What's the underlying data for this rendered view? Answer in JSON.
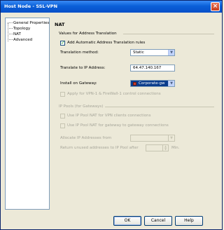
{
  "window": {
    "title": "Host Node - SSL-VPN",
    "close_icon": "close-icon"
  },
  "tree": {
    "items": [
      {
        "label": "General Properties"
      },
      {
        "label": "Topology"
      },
      {
        "label": "NAT"
      },
      {
        "label": "Advanced"
      }
    ]
  },
  "nat": {
    "heading": "NAT",
    "section_title": "Values for Address Translation",
    "add_auto_rules_label": "Add Automatic Address Translation rules",
    "add_auto_rules_checked": true,
    "translation_method_label": "Translation method:",
    "translation_method_value": "Static",
    "translate_ip_label": "Translate to IP Address:",
    "translate_ip_value": "64.47.140.167",
    "install_on_label": "Install on Gateway:",
    "install_on_value": "Corporate-gw",
    "apply_vpn_label": "Apply for VPN-1 & FireWall-1 control connections",
    "ip_pools_title": "IP Pools (for Gateways)",
    "use_pool_nat_label": "Use IP Pool NAT for VPN clients connections",
    "use_pool_nat_gw_label": "Use IP Pool NAT for gateway to gateway connections",
    "allocate_label": "Allocate IP Addresses from",
    "return_unused_label": "Return unused addresses to IP Pool after",
    "min_unit": "Min."
  },
  "buttons": {
    "ok": "OK",
    "cancel": "Cancel",
    "help": "Help"
  },
  "colors": {
    "title_bar": "#0a5fd8",
    "dialog_bg": "#ece9d8",
    "disabled_text": "#a7a69a"
  }
}
